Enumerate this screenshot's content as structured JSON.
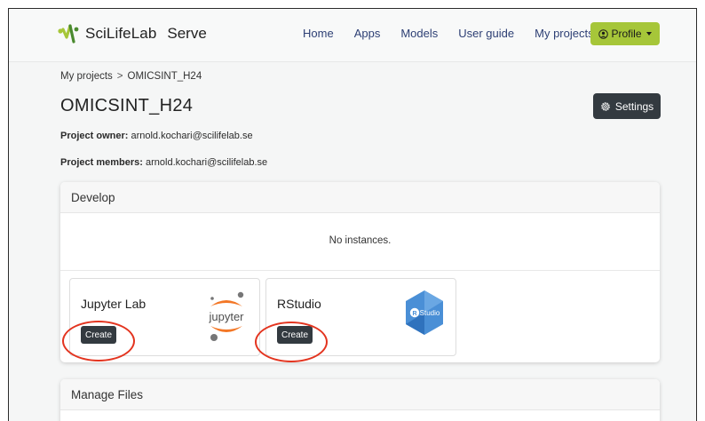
{
  "navbar": {
    "brand_name": "SciLifeLab",
    "brand_product": "Serve",
    "links": [
      "Home",
      "Apps",
      "Models",
      "User guide",
      "My projects"
    ],
    "profile_label": "Profile",
    "brand_color": "#a6c639"
  },
  "breadcrumb": {
    "parent": "My projects",
    "separator": ">",
    "current": "OMICSINT_H24"
  },
  "project": {
    "title": "OMICSINT_H24",
    "settings_label": "Settings",
    "owner_label": "Project owner:",
    "owner_value": "arnold.kochari@scilifelab.se",
    "members_label": "Project members:",
    "members_value": "arnold.kochari@scilifelab.se"
  },
  "develop": {
    "title": "Develop",
    "empty_text": "No instances.",
    "apps": [
      {
        "name": "Jupyter Lab",
        "button": "Create",
        "icon": "jupyter-logo",
        "logo_text": "jupyter"
      },
      {
        "name": "RStudio",
        "button": "Create",
        "icon": "rstudio-logo",
        "logo_text": "Studio"
      }
    ]
  },
  "manage_files": {
    "title": "Manage Files"
  },
  "annotation_color": "#e3341f"
}
